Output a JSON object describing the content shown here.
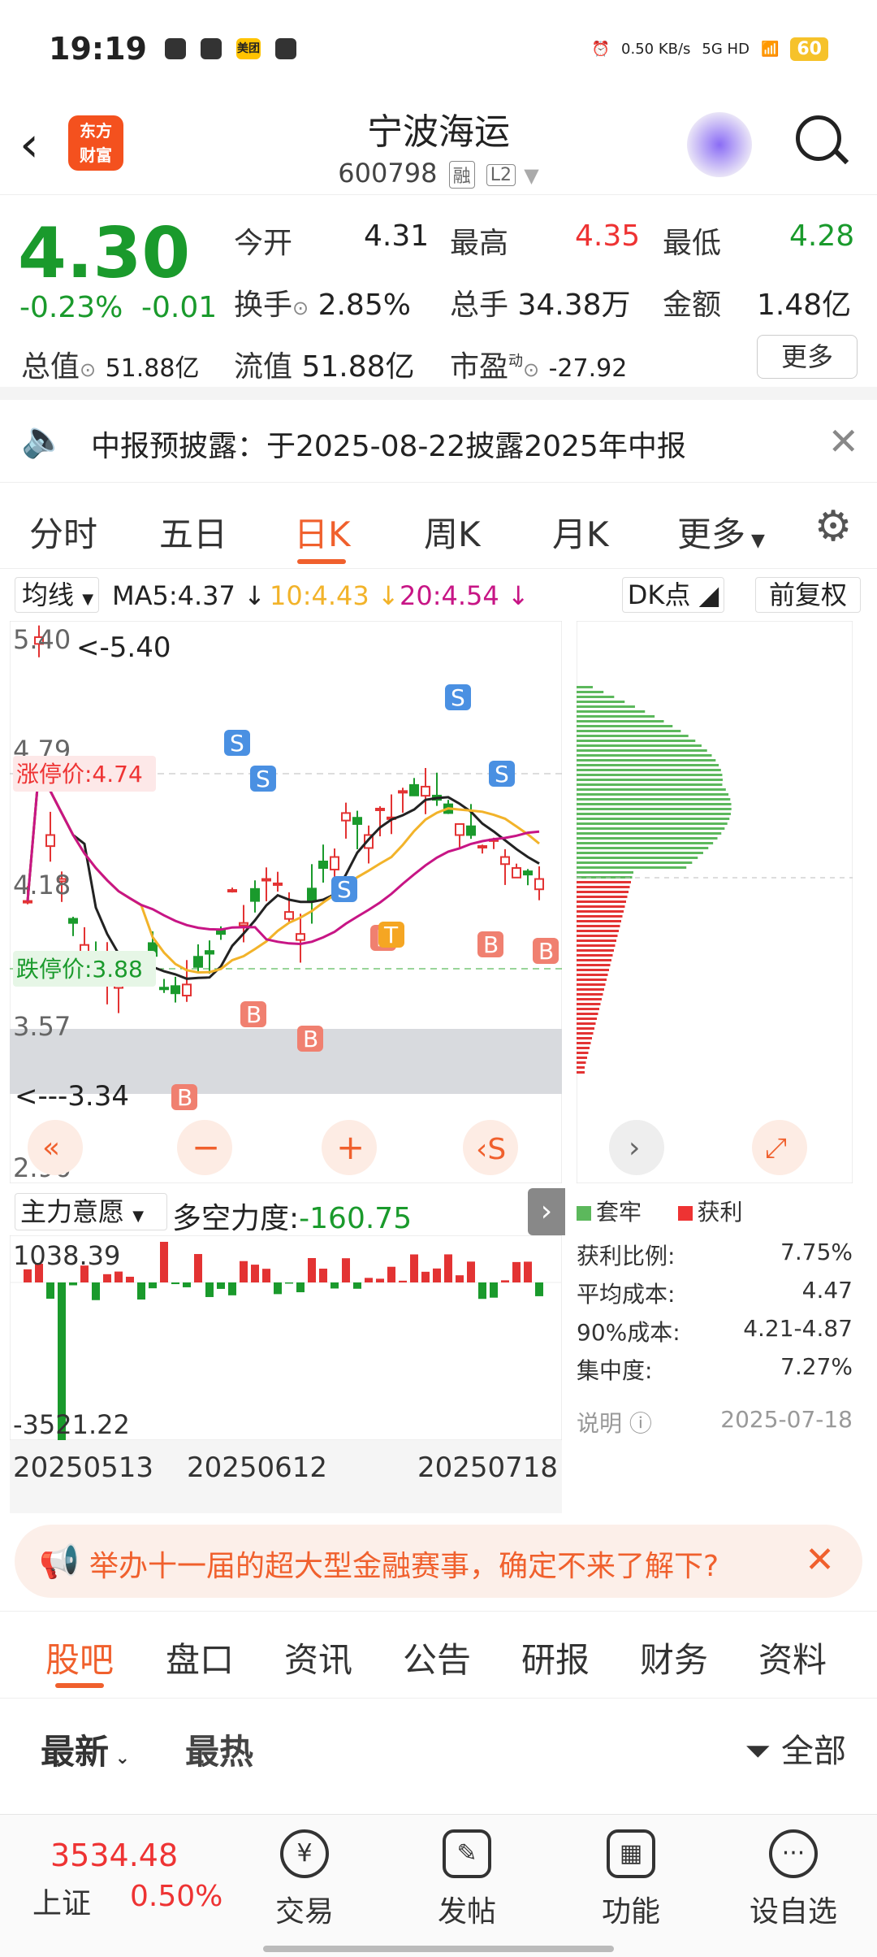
{
  "status_bar": {
    "time": "19:19",
    "network_speed": "0.50\nKB/s",
    "net": "5G HD",
    "battery": "60"
  },
  "header": {
    "app_logo": "东方\n财富",
    "stock_name": "宁波海运",
    "stock_code": "600798",
    "tag1": "融",
    "tag2": "L2"
  },
  "quote": {
    "price": "4.30",
    "change_pct": "-0.23%",
    "change": "-0.01",
    "open_label": "今开",
    "open": "4.31",
    "high_label": "最高",
    "high": "4.35",
    "low_label": "最低",
    "low": "4.28",
    "turnover_label": "换手",
    "turnover": "2.85%",
    "volume_label": "总手",
    "volume": "34.38万",
    "amount_label": "金额",
    "amount": "1.48亿",
    "mktcap_label": "总值",
    "mktcap": "51.88亿",
    "float_label": "流值",
    "float": "51.88亿",
    "pe_label": "市盈",
    "pe_sup": "动",
    "pe": "-27.92",
    "more": "更多"
  },
  "notice": {
    "text": "中报预披露：于2025-08-22披露2025年中报"
  },
  "tabs": [
    "分时",
    "五日",
    "日K",
    "周K",
    "月K",
    "更多"
  ],
  "ma": {
    "select": "均线",
    "ma5": "MA5:4.37",
    "ma10": "10:4.43",
    "ma20": "20:4.54",
    "dk": "DK点",
    "fq": "前复权"
  },
  "kline": {
    "y_labels": [
      "5.40",
      "4.79",
      "4.18",
      "3.57",
      "2.96"
    ],
    "max_label": "<-5.40",
    "min_label": "<---3.34",
    "limit_up": "涨停价:4.74",
    "limit_down": "跌停价:3.88",
    "markers": [
      "S",
      "S",
      "S",
      "S",
      "S",
      "B",
      "B",
      "B",
      "B",
      "B",
      "B",
      "T"
    ]
  },
  "indicator": {
    "select": "主力意愿",
    "label": "多空力度:",
    "value": "-160.75",
    "max": "1038.39",
    "min": "-3521.22"
  },
  "dates": [
    "20250513",
    "20250612",
    "20250718"
  ],
  "chip": {
    "legend_trapped": "套牢",
    "legend_profit": "获利",
    "rows": [
      {
        "k": "获利比例:",
        "v": "7.75%"
      },
      {
        "k": "平均成本:",
        "v": "4.47"
      },
      {
        "k": "90%成本:",
        "v": "4.21-4.87"
      },
      {
        "k": "集中度:",
        "v": "7.27%"
      }
    ],
    "note": "说明",
    "date": "2025-07-18"
  },
  "banner": {
    "text": "举办十一届的超大型金融赛事，确定不来了解下?"
  },
  "bottom_tabs": [
    "股吧",
    "盘口",
    "资讯",
    "公告",
    "研报",
    "财务",
    "资料"
  ],
  "sort": {
    "latest": "最新",
    "hot": "最热",
    "filter": "全部"
  },
  "footer": {
    "index_value": "3534.48",
    "index_name": "上证",
    "index_pct": "0.50%",
    "buttons": [
      "交易",
      "发帖",
      "功能",
      "设自选"
    ]
  },
  "colors": {
    "up": "#e33333",
    "down": "#1a9a2c",
    "accent": "#f0602d"
  }
}
